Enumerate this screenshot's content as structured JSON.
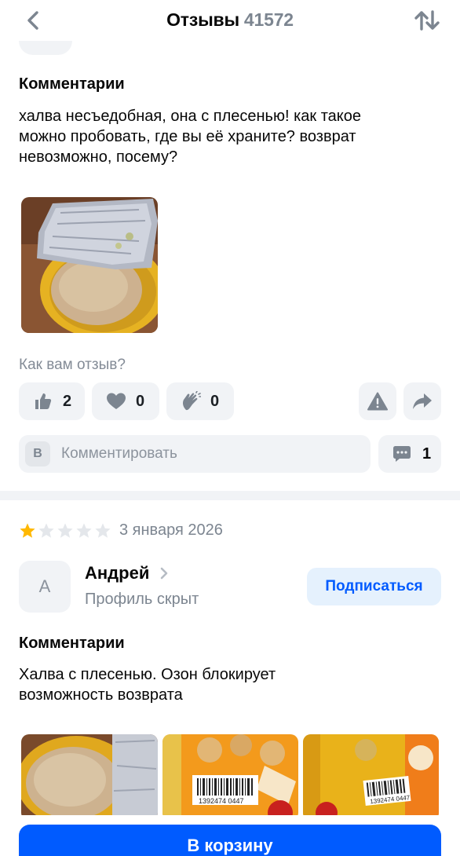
{
  "header": {
    "title": "Отзывы",
    "count": "41572",
    "back_icon": "chevron-left-icon",
    "sort_icon": "sort-arrows-icon"
  },
  "review1": {
    "comments_heading": "Комментарии",
    "comment_lines": [
      "халва несъедобная, она с плесенью! как такое",
      "можно пробовать, где вы её храните? возврат",
      "невозможно, посему?"
    ],
    "question": "Как вам отзыв?",
    "reactions": [
      {
        "icon": "thumbs-up-icon",
        "count": "2"
      },
      {
        "icon": "heart-icon",
        "count": "0"
      },
      {
        "icon": "clap-icon",
        "count": "0"
      }
    ],
    "comment_input": {
      "avatar_letter": "В",
      "placeholder": "Комментировать"
    },
    "comments_count": "1"
  },
  "review2": {
    "rating": 1,
    "max_rating": 5,
    "date": "3 января 2026",
    "avatar_letter": "А",
    "author": "Андрей",
    "author_sub": "Профиль скрыт",
    "subscribe_label": "Подписаться",
    "comments_heading": "Комментарии",
    "comment_lines": [
      "Халва с плесенью. Озон блокирует",
      "возможность возврата"
    ],
    "barcode_1": "1392474 0447",
    "barcode_2": "1392474 0447"
  },
  "colors": {
    "accent": "#005bff",
    "star": "#ffb800",
    "star_empty": "#e4e7eb",
    "muted": "#7c8590"
  },
  "footer": {
    "cart_label": "В корзину"
  }
}
